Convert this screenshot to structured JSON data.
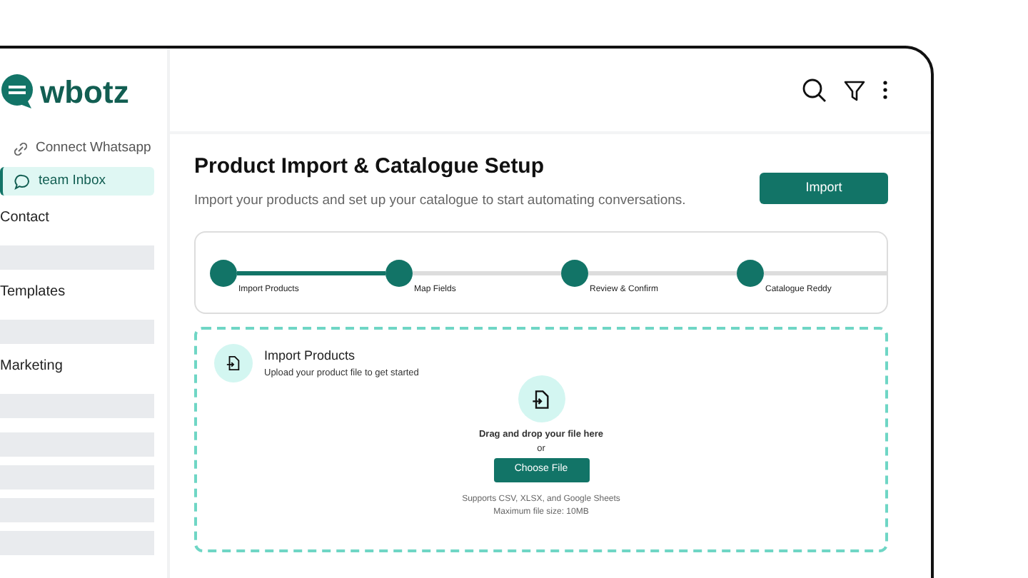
{
  "sidebar": {
    "logo": "wbotz",
    "items": [
      {
        "label": "Connect Whatsapp",
        "kind": "link",
        "selected": false
      },
      {
        "label": "team Inbox",
        "kind": "chat",
        "selected": true
      }
    ],
    "sections": [
      {
        "label": "Contact"
      },
      {
        "label": "Templates"
      },
      {
        "label": "Marketing"
      }
    ]
  },
  "page": {
    "title": "Product Import & Catalogue Setup",
    "subtitle": "Import your products and set up your catalogue to start automating conversations.",
    "button": "Import"
  },
  "stepper": {
    "steps": [
      {
        "label": "Import Products",
        "completed": true
      },
      {
        "label": "Map Fields",
        "completed": false
      },
      {
        "label": "Review & Confirm",
        "completed": false
      },
      {
        "label": "Catalogue Reddy",
        "completed": false
      }
    ]
  },
  "upload": {
    "title": "Import Products",
    "subtitle": "Upload your product file to get started",
    "drop_text": "Drag and drop your file here",
    "or": "or",
    "button": "Choose File",
    "formats": "Supports CSV, XLSX, and Google Sheets",
    "max_size": "Maximum file size: 10MB"
  }
}
